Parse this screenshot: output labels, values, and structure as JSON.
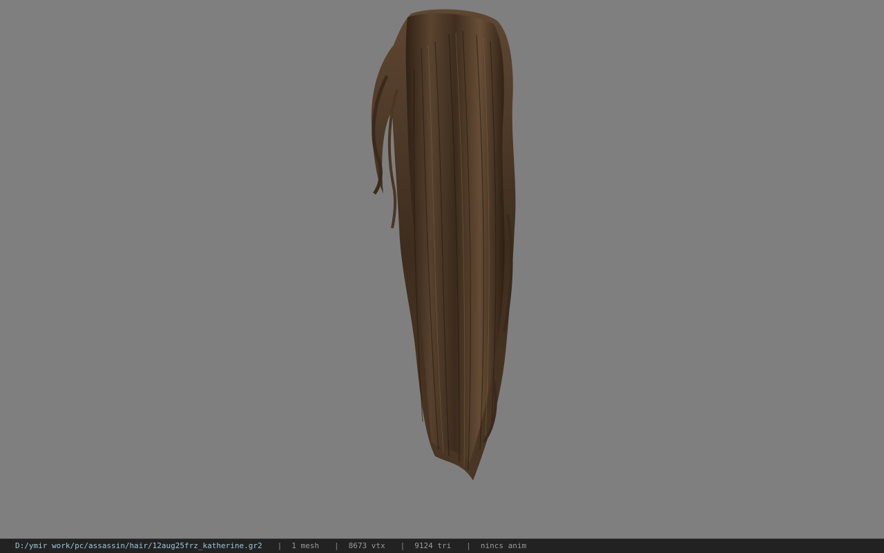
{
  "viewport": {
    "background_color": "#7f7f7f",
    "model_description": "hair-model-ponytail",
    "hair_color_dark": "#2a1d12",
    "hair_color_mid": "#5a4330",
    "hair_color_light": "#7a5e44"
  },
  "statusbar": {
    "file_path": "D:/ymir work/pc/assassin/hair/12aug25frz_katherine.gr2",
    "separator": "|",
    "mesh_count": "1 mesh",
    "vertex_count": "8673 vtx",
    "triangle_count": "9124 tri",
    "anim_status": "nincs anim"
  }
}
